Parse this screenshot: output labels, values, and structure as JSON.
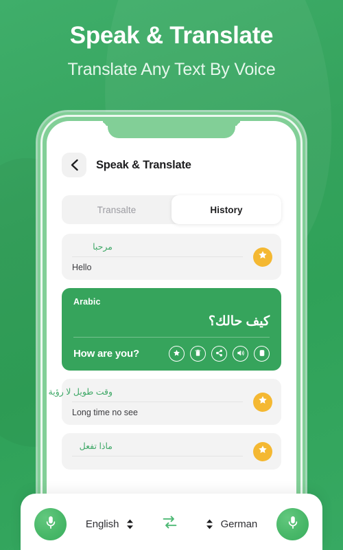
{
  "promo": {
    "headline": "Speak & Translate",
    "subheadline": "Translate Any Text By Voice"
  },
  "colors": {
    "brand_green": "#35a35d",
    "card_green": "#36a45c",
    "phone_frame": "#82cf97",
    "star_gold": "#f4b832",
    "accent_text_green": "#3fa867",
    "mic_green": "#49b869",
    "list_bg": "#f3f3f3",
    "tab_bg": "#f2f2f2"
  },
  "appbar": {
    "back_icon": "chevron-left-icon",
    "title": "Speak & Translate"
  },
  "tabs": [
    {
      "label": "Transalte",
      "active": false
    },
    {
      "label": "History",
      "active": true
    }
  ],
  "history": [
    {
      "source_text": "مرحبا",
      "target_text": "Hello",
      "favorite": true,
      "favorite_icon": "star-icon"
    }
  ],
  "active_card": {
    "language": "Arabic",
    "source_text": "كيف حالك؟",
    "target_text": "How are you?",
    "actions": [
      {
        "name": "favorite",
        "icon": "star-icon"
      },
      {
        "name": "delete",
        "icon": "trash-icon"
      },
      {
        "name": "share",
        "icon": "share-icon"
      },
      {
        "name": "speak",
        "icon": "speaker-icon"
      },
      {
        "name": "copy",
        "icon": "copy-icon"
      }
    ]
  },
  "history_after": [
    {
      "source_text": "وقت طويل لا رؤية",
      "target_text": "Long time no see",
      "favorite": true,
      "favorite_icon": "star-icon"
    },
    {
      "source_text": "ماذا تفعل",
      "target_text": "",
      "favorite": true,
      "favorite_icon": "star-icon"
    }
  ],
  "bottom_bar": {
    "left_mic_icon": "microphone-icon",
    "right_mic_icon": "microphone-icon",
    "source_language": "English",
    "target_language": "German",
    "swap_icon": "swap-arrows-icon",
    "stepper_icon": "up-down-chevron-icon"
  }
}
